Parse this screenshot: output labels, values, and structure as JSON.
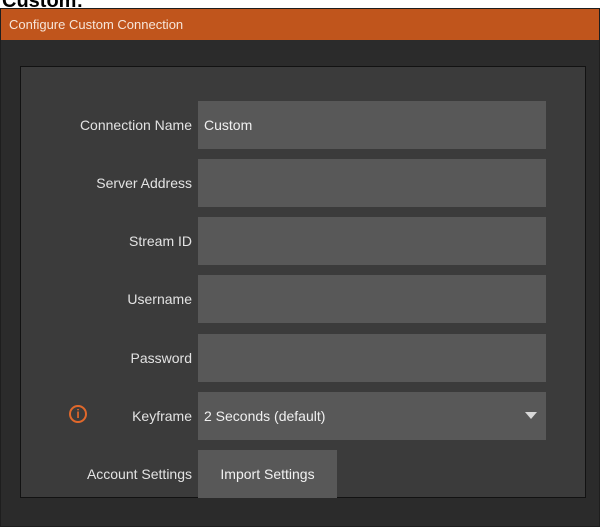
{
  "header_fragment": "Custom:",
  "dialog": {
    "title": "Configure Custom Connection"
  },
  "form": {
    "connection_name": {
      "label": "Connection Name",
      "value": "Custom"
    },
    "server_address": {
      "label": "Server Address",
      "value": ""
    },
    "stream_id": {
      "label": "Stream ID",
      "value": ""
    },
    "username": {
      "label": "Username",
      "value": ""
    },
    "password": {
      "label": "Password",
      "value": ""
    },
    "keyframe": {
      "label": "Keyframe",
      "value": "2 Seconds (default)",
      "info_icon": "info-icon"
    },
    "account_settings": {
      "label": "Account Settings",
      "button_label": "Import Settings"
    }
  },
  "colors": {
    "titlebar": "#c0551c",
    "accent_icon": "#e1682b",
    "dialog_bg": "#2b2b2b",
    "panel_bg": "#3b3b3b",
    "field_bg": "#585858"
  }
}
